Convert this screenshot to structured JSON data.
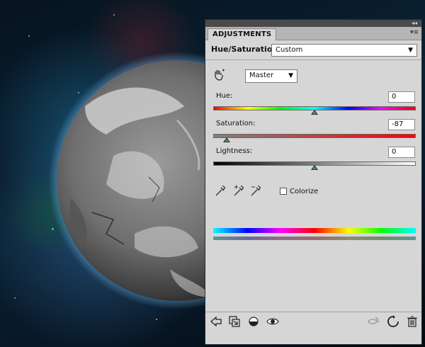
{
  "panel": {
    "tab_label": "ADJUSTMENTS",
    "title": "Hue/Saturation",
    "preset_value": "Custom",
    "channel_value": "Master"
  },
  "controls": {
    "hue_label": "Hue:",
    "hue_value": "0",
    "saturation_label": "Saturation:",
    "saturation_value": "-87",
    "lightness_label": "Lightness:",
    "lightness_value": "0",
    "colorize_label": "Colorize",
    "colorize_checked": false
  },
  "sliders": {
    "hue_fraction": 0.5,
    "saturation_fraction": 0.065,
    "lightness_fraction": 0.5
  },
  "footer_icons": [
    "back-arrow-icon",
    "clip-to-layer-icon",
    "layer-visibility-toggle-icon",
    "eye-icon",
    "view-previous-state-icon",
    "reset-icon",
    "trash-icon"
  ],
  "colors": {
    "panel_bg": "#d6d6d6",
    "slider_thumb": "#3f9e5a"
  }
}
